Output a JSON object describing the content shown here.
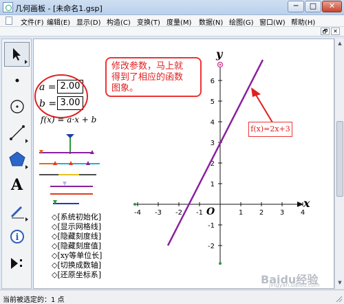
{
  "window": {
    "title": "几何画板 - [未命名1.gsp]",
    "min_glyph": "─",
    "max_glyph": "□",
    "close_glyph": "✕"
  },
  "menu": {
    "items": [
      "文件(F)",
      "编辑(E)",
      "显示(D)",
      "构造(C)",
      "变换(T)",
      "度量(M)",
      "数据(N)",
      "绘图(G)",
      "窗口(W)",
      "帮助(H)"
    ]
  },
  "mdi": {
    "restore_glyph": "🗗",
    "close_glyph": "✕"
  },
  "toolbox": {
    "tools": [
      "select-arrow",
      "point",
      "compass",
      "straightedge",
      "polygon",
      "text",
      "marker",
      "information",
      "custom"
    ],
    "selected": "select-arrow",
    "text_glyph": "A",
    "info_glyph": "i"
  },
  "params": {
    "a_label": "a =",
    "a_value": "2.00",
    "b_label": "b =",
    "b_value": "3.00"
  },
  "function_definition": "f(x) = a·x + b",
  "buttons": [
    "◇[系统初始化]",
    "◇[显示网格线]",
    "◇[隐藏刻度线]",
    "◇[隐藏刻度值]",
    "◇[xy等单位长]",
    "◇[切换成数轴]",
    "◇[还原坐标系]"
  ],
  "callout": {
    "line1": "修改参数，马上就",
    "line2": "得到了相应的函数",
    "line3": "图象。"
  },
  "graph_label": "f(x)=2x+3",
  "axes": {
    "x_name": "x",
    "y_name": "y",
    "origin": "O",
    "x_ticks": [
      "-4",
      "-3",
      "-2",
      "-1",
      "1",
      "2",
      "3",
      "4"
    ],
    "y_ticks": [
      "6",
      "5",
      "4",
      "3",
      "2",
      "1",
      "-1",
      "-2"
    ]
  },
  "status": {
    "text": "当前被选定的：1 点"
  },
  "watermark": {
    "main": "Baidu经验",
    "sub": "jingyan.baidu.com"
  },
  "colors": {
    "line": "#8a1fa0",
    "callout": "#e02020",
    "axis_point": "#2a9a3a",
    "unit_point": "#d64a9a"
  }
}
